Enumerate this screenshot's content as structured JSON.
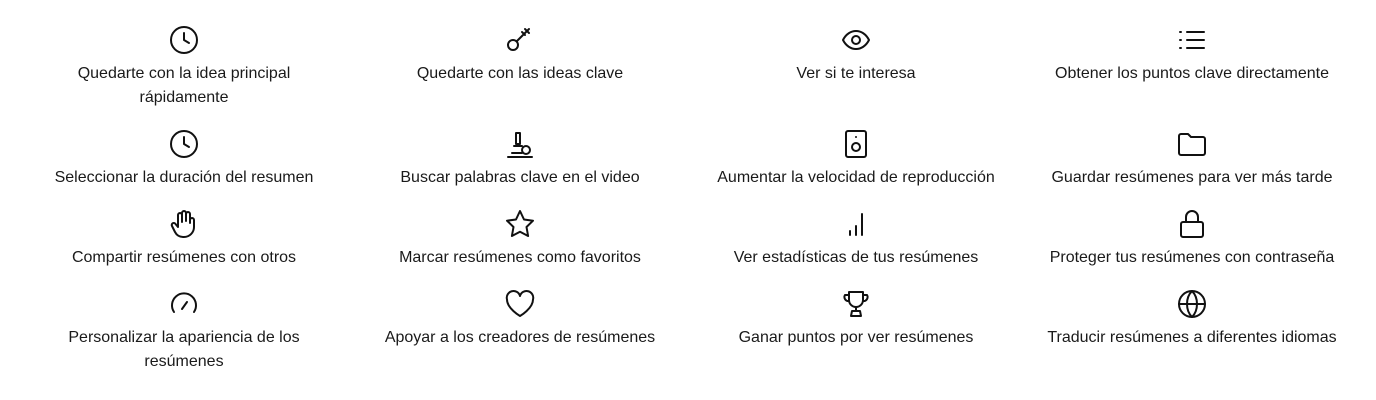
{
  "features": [
    {
      "label": "Quedarte con la idea principal rápidamente",
      "icon": "clock-icon"
    },
    {
      "label": "Quedarte con las ideas clave",
      "icon": "key-icon"
    },
    {
      "label": "Ver si te interesa",
      "icon": "eye-icon"
    },
    {
      "label": "Obtener los puntos clave directamente",
      "icon": "list-icon"
    },
    {
      "label": "Seleccionar la duración del resumen",
      "icon": "clock-icon"
    },
    {
      "label": "Buscar palabras clave en el video",
      "icon": "microscope-icon"
    },
    {
      "label": "Aumentar la velocidad de reproducción",
      "icon": "speaker-icon"
    },
    {
      "label": "Guardar resúmenes para ver más tarde",
      "icon": "folder-icon"
    },
    {
      "label": "Compartir resúmenes con otros",
      "icon": "hand-icon"
    },
    {
      "label": "Marcar resúmenes como favoritos",
      "icon": "star-icon"
    },
    {
      "label": "Ver estadísticas de tus resúmenes",
      "icon": "bar-chart-icon"
    },
    {
      "label": "Proteger tus resúmenes con contraseña",
      "icon": "lock-icon"
    },
    {
      "label": "Personalizar la apariencia de los resúmenes",
      "icon": "gauge-icon"
    },
    {
      "label": "Apoyar a los creadores de resúmenes",
      "icon": "heart-icon"
    },
    {
      "label": "Ganar puntos por ver resúmenes",
      "icon": "trophy-icon"
    },
    {
      "label": "Traducir resúmenes a diferentes idiomas",
      "icon": "globe-icon"
    }
  ]
}
